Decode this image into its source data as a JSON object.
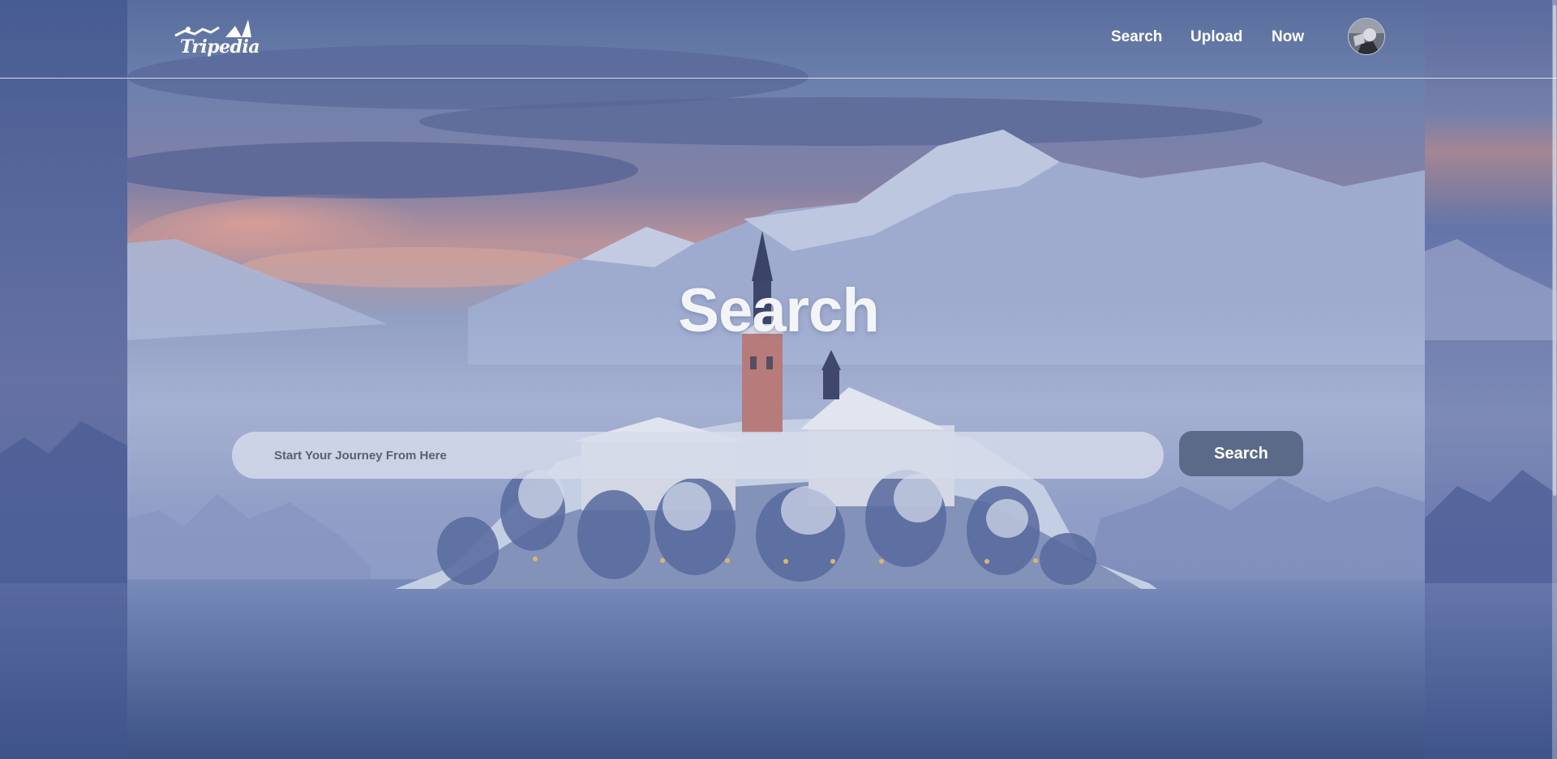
{
  "app": {
    "brand": "Tripedia"
  },
  "header": {
    "nav": [
      {
        "label": "Search"
      },
      {
        "label": "Upload"
      },
      {
        "label": "Now"
      }
    ]
  },
  "hero": {
    "title": "Search",
    "search": {
      "placeholder": "Start Your Journey From Here",
      "value": "",
      "button_label": "Search"
    }
  },
  "colors": {
    "search_button": "#5c6a8a",
    "search_input": "#d7dcec",
    "text": "#ffffff"
  },
  "icons": {
    "logo": "tripedia-logo-icon",
    "avatar": "user-avatar"
  }
}
